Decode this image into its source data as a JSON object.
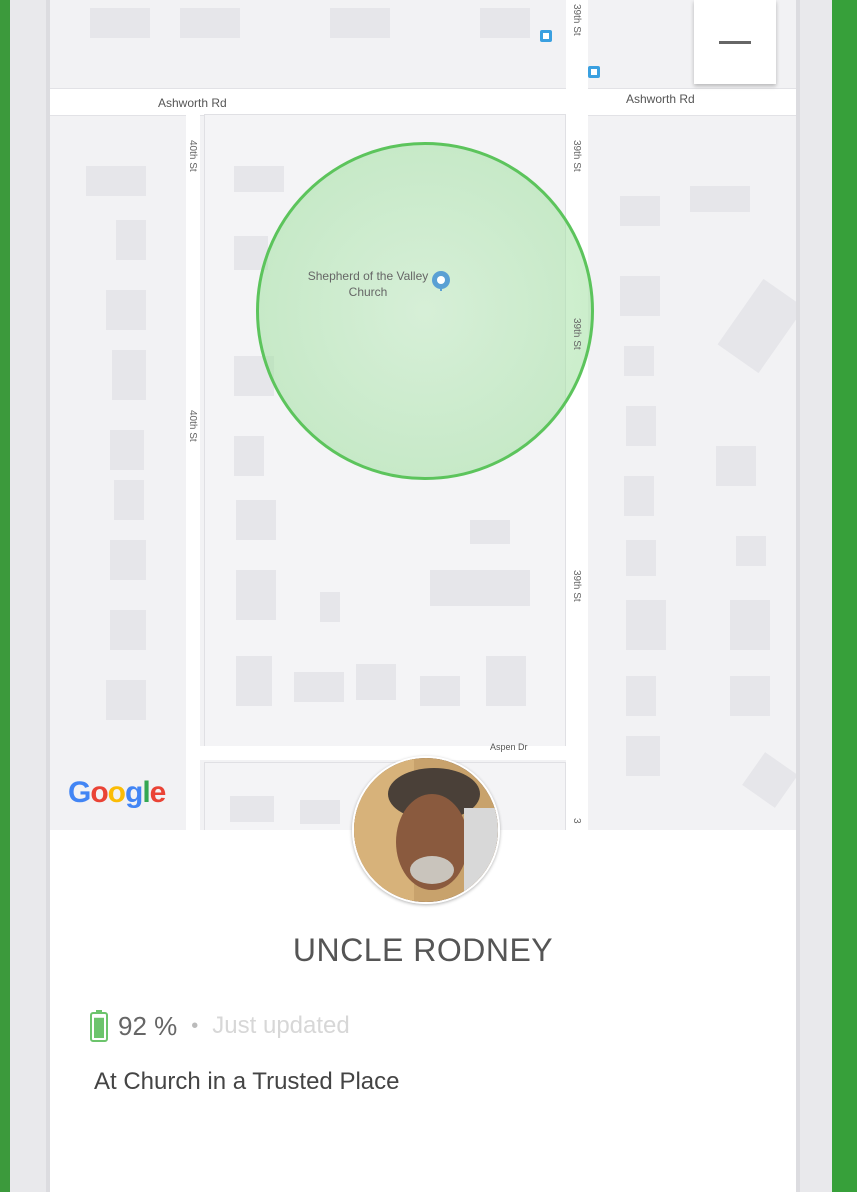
{
  "map": {
    "road_top_left": "Ashworth Rd",
    "road_top_right": "Ashworth Rd",
    "street_left_top": "40th St",
    "street_left_mid": "40th St",
    "street_right_1": "39th St",
    "street_right_2": "39th St",
    "street_right_3": "39th St",
    "street_right_top": "39th St",
    "street_right_bottom": "3",
    "street_aspen": "Aspen Dr",
    "place_name": "Shepherd of the Valley Church",
    "zoom_out_icon": "minus-icon",
    "google_logo": "Google"
  },
  "person": {
    "name": "UNCLE RODNEY",
    "battery": "92 %",
    "battery_level": 0.92,
    "updated": "Just updated",
    "status": "At Church in a Trusted Place"
  },
  "colors": {
    "accent_green": "#37a03a",
    "geofence_green": "#5cc45c"
  }
}
